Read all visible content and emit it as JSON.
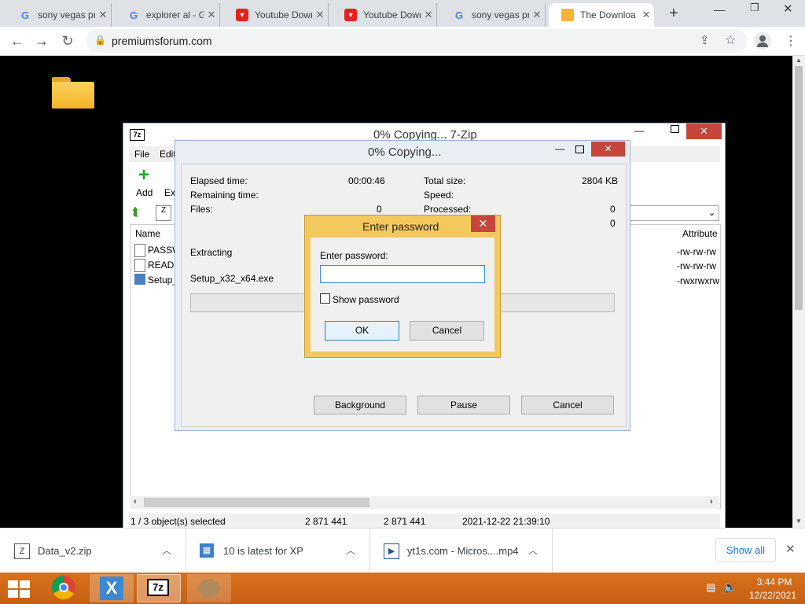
{
  "browser": {
    "tabs": [
      {
        "title": "sony vegas pr",
        "favicon": "google-icon",
        "active": false
      },
      {
        "title": "explorer al - G",
        "favicon": "google-icon",
        "active": false
      },
      {
        "title": "Youtube Down",
        "favicon": "youtube-downloader-icon",
        "active": false
      },
      {
        "title": "Youtube Down",
        "favicon": "youtube-downloader-icon",
        "active": false
      },
      {
        "title": "sony vegas pr",
        "favicon": "google-icon",
        "active": false
      },
      {
        "title": "The Downloa",
        "favicon": "folder-icon",
        "active": true
      }
    ],
    "new_tab": "+",
    "url": "premiumsforum.com"
  },
  "sevenzip": {
    "title": "0% Copying... 7-Zip",
    "menu": [
      "File",
      "Edit"
    ],
    "toolbar": [
      "Add",
      "Ext"
    ],
    "columns": {
      "name": "Name",
      "attributes": "Attribute"
    },
    "files": [
      {
        "name": "PASSW",
        "attr": "-rw-rw-rw"
      },
      {
        "name": "READ I",
        "attr": "-rw-rw-rw"
      },
      {
        "name": "Setup_",
        "attr": "-rwxrwxrw"
      }
    ],
    "status": {
      "selection": "1 / 3 object(s) selected",
      "size": "2 871 441",
      "packed": "2 871 441",
      "modified": "2021-12-22 21:39:10"
    }
  },
  "copy_dialog": {
    "title": "0% Copying...",
    "elapsed_label": "Elapsed time:",
    "elapsed_value": "00:00:46",
    "remaining_label": "Remaining time:",
    "files_label": "Files:",
    "files_value": "0",
    "total_label": "Total size:",
    "total_value": "2804 KB",
    "speed_label": "Speed:",
    "processed_label": "Processed:",
    "processed_value": "0",
    "extra_value": "0",
    "extracting_label": "Extracting",
    "current_file": "Setup_x32_x64.exe",
    "progress_percent": 0,
    "buttons": {
      "background": "Background",
      "pause": "Pause",
      "cancel": "Cancel"
    }
  },
  "password_dialog": {
    "title": "Enter password",
    "field_label": "Enter password:",
    "password_value": "",
    "show_password_label": "Show password",
    "show_password_checked": false,
    "ok": "OK",
    "cancel": "Cancel"
  },
  "downloads": {
    "items": [
      {
        "name": "Data_v2.zip",
        "icon": "zip-file-icon"
      },
      {
        "name": "10 is latest for XP",
        "icon": "installer-icon"
      },
      {
        "name": "yt1s.com - Micros....mp4",
        "icon": "video-file-icon"
      }
    ],
    "show_all": "Show all"
  },
  "taskbar": {
    "time": "3:44 PM",
    "date": "12/22/2021"
  }
}
